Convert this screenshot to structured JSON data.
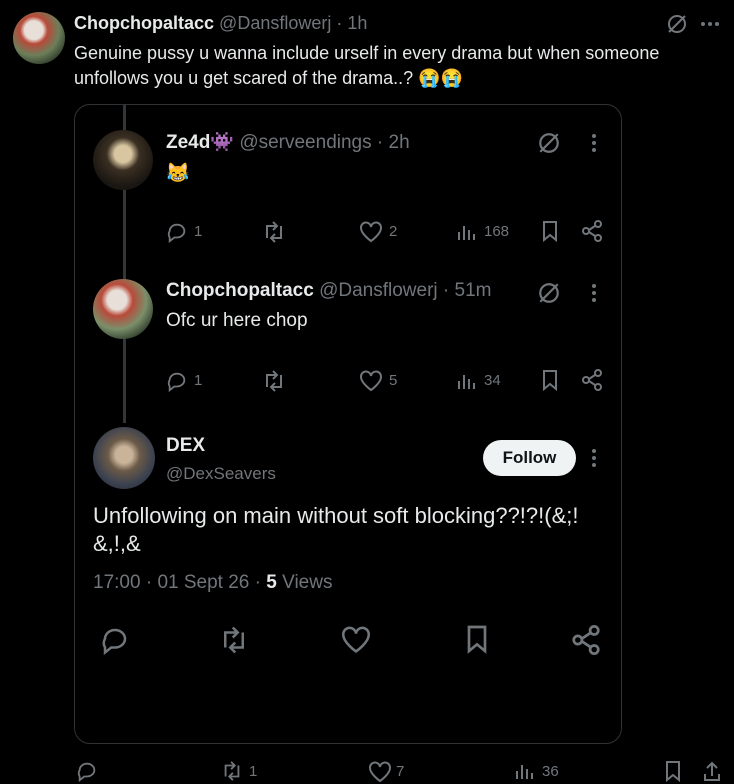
{
  "outer": {
    "author": "Chopchopaltacc",
    "handle": "@Dansflowerj",
    "time": "1h",
    "text_line1": "Genuine pussy u wanna include urself in every drama but when someone",
    "text_line2": "unfollows you u get scared of the drama..? 😭😭",
    "actions": {
      "reply": "",
      "repost": "1",
      "like": "7",
      "views": "36"
    }
  },
  "thread": [
    {
      "author": "Ze4d",
      "emoji": "👾",
      "handle": "@serveendings",
      "time": "2h",
      "text": "😹",
      "actions": {
        "reply": "1",
        "repost": "",
        "like": "2",
        "views": "168"
      }
    },
    {
      "author": "Chopchopaltacc",
      "handle": "@Dansflowerj",
      "time": "51m",
      "text": "Ofc ur here chop",
      "actions": {
        "reply": "1",
        "repost": "",
        "like": "5",
        "views": "34"
      }
    }
  ],
  "main": {
    "author": "DEX",
    "handle": "@DexSeavers",
    "follow_label": "Follow",
    "text_line1": "Unfollowing on main without soft blocking??!?!(&;!",
    "text_line2": "&,!,&",
    "time": "17:00",
    "date": "01 Sept 26",
    "views_count": "5",
    "views_label": "Views"
  },
  "colors": {
    "background": "#000000",
    "text": "#e7e9ea",
    "muted": "#71767b",
    "border": "#2f3336",
    "follow_bg": "#eff3f4"
  }
}
